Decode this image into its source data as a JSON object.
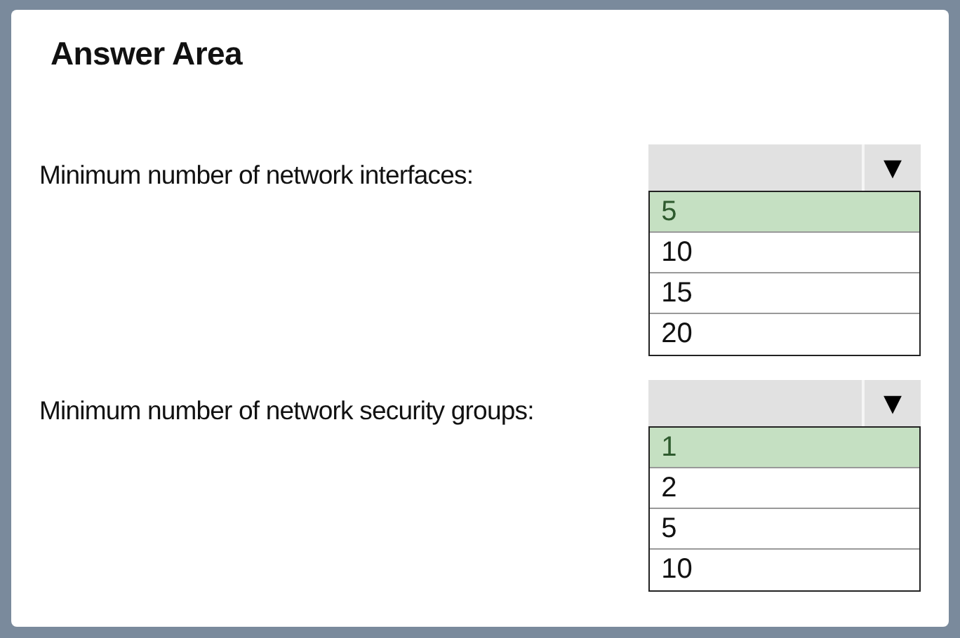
{
  "title": "Answer Area",
  "questions": [
    {
      "label": "Minimum number of network interfaces:",
      "arrow": "▼",
      "options": [
        {
          "text": "5",
          "selected": true
        },
        {
          "text": "10",
          "selected": false
        },
        {
          "text": "15",
          "selected": false
        },
        {
          "text": "20",
          "selected": false
        }
      ]
    },
    {
      "label": "Minimum number of network security groups:",
      "arrow": "▼",
      "options": [
        {
          "text": "1",
          "selected": true
        },
        {
          "text": "2",
          "selected": false
        },
        {
          "text": "5",
          "selected": false
        },
        {
          "text": "10",
          "selected": false
        }
      ]
    }
  ]
}
